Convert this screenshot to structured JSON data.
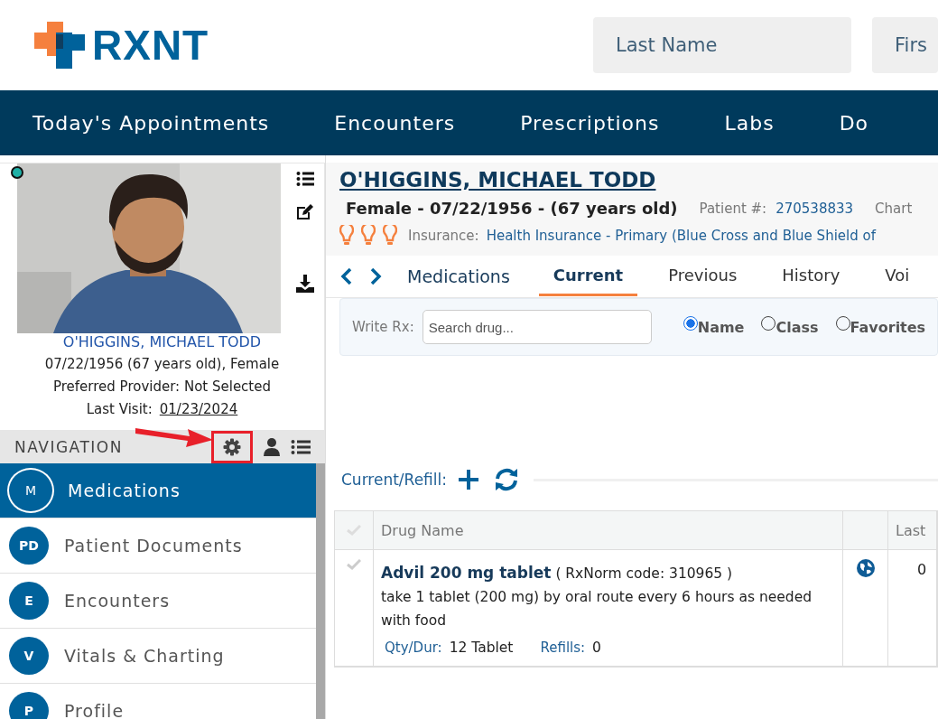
{
  "header": {
    "logo": "RXNT",
    "search_fields": [
      {
        "placeholder": "Last Name"
      },
      {
        "placeholder": "Firs"
      }
    ]
  },
  "top_nav": [
    {
      "label": "Today's Appointments"
    },
    {
      "label": "Encounters"
    },
    {
      "label": "Prescriptions"
    },
    {
      "label": "Labs"
    },
    {
      "label": "Do"
    }
  ],
  "profile": {
    "name": "O'HIGGINS, MICHAEL TODD",
    "details": "07/22/1956 (67 years old), Female",
    "provider": "Preferred Provider: Not Selected",
    "last_visit_label": "Last Visit:",
    "last_visit": "01/23/2024"
  },
  "navigation": {
    "title": "NAVIGATION",
    "items": [
      {
        "badge": "M",
        "label": "Medications",
        "selected": true
      },
      {
        "badge": "PD",
        "label": "Patient Documents",
        "selected": false
      },
      {
        "badge": "E",
        "label": "Encounters",
        "selected": false
      },
      {
        "badge": "V",
        "label": "Vitals & Charting",
        "selected": false
      },
      {
        "badge": "P",
        "label": "Profile",
        "selected": false
      }
    ]
  },
  "patient": {
    "name": "O'HIGGINS, MICHAEL TODD",
    "summary": "Female - 07/22/1956 - (67 years old)",
    "patient_no_label": "Patient #:",
    "patient_no": "270538833",
    "chart_label": "Chart",
    "insurance_label": "Insurance:",
    "insurance": "Health Insurance - Primary (Blue Cross and Blue Shield of"
  },
  "section_title": "Medications",
  "tabs": [
    {
      "label": "Current",
      "selected": true
    },
    {
      "label": "Previous",
      "selected": false
    },
    {
      "label": "History",
      "selected": false
    },
    {
      "label": "Voi",
      "selected": false
    }
  ],
  "write_rx": {
    "label": "Write Rx:",
    "placeholder": "Search drug...",
    "options": [
      {
        "label": "Name",
        "selected": true
      },
      {
        "label": "Class",
        "selected": false
      },
      {
        "label": "Favorites",
        "selected": false
      }
    ]
  },
  "current_refill": {
    "label": "Current/Refill:"
  },
  "table": {
    "columns": [
      "Drug Name",
      "Last"
    ],
    "rows": [
      {
        "drug": "Advil 200 mg tablet",
        "code": "( RxNorm code: 310965 )",
        "sig": "take 1 tablet (200 mg) by oral route every 6 hours as needed with food",
        "qty_label": "Qty/Dur:",
        "qty": "12 Tablet",
        "refills_label": "Refills:",
        "refills": "0",
        "last": "0"
      }
    ]
  }
}
